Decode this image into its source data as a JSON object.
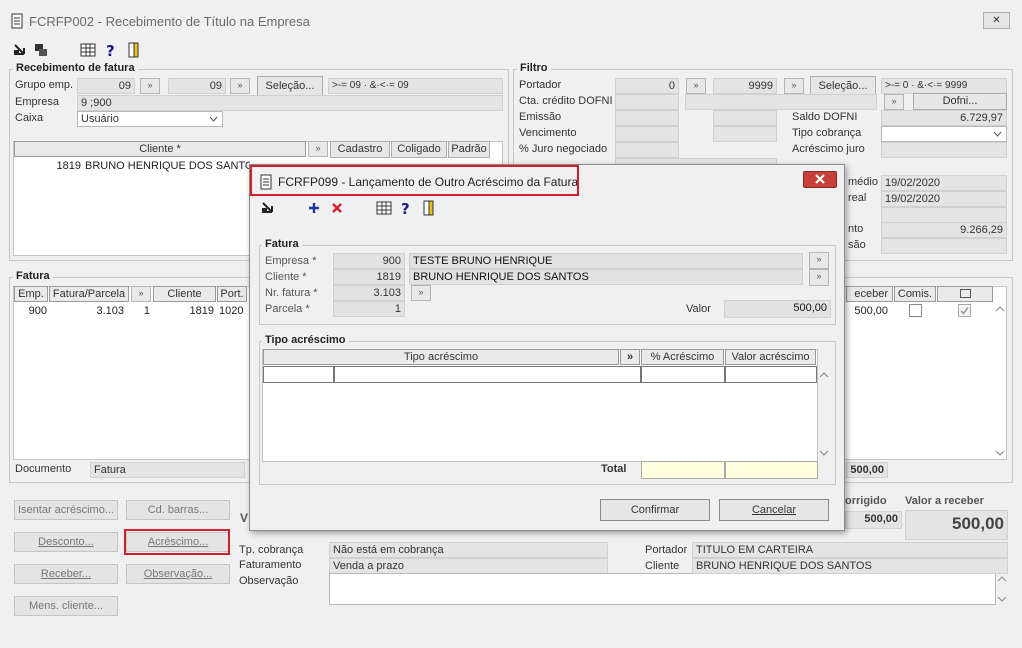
{
  "window": {
    "title": "FCRFP002 - Recebimento de Título na Empresa",
    "close_glyph": "✕"
  },
  "receb": {
    "section_title": "Recebimento de fatura",
    "grupo_label": "Grupo emp.",
    "grupo_from": "09",
    "grupo_to": "09",
    "selecao_label": "Seleção...",
    "grupo_range": ">-= 09 · &·<·= 09",
    "empresa_label": "Empresa",
    "empresa_value": "9 ;900",
    "caixa_label": "Caixa",
    "caixa_value": "Usuário",
    "cliente_col": "Cliente *",
    "cadastro": "Cadastro",
    "coligado": "Coligado",
    "padrao": "Padrão",
    "row_code": "1819",
    "row_name": "BRUNO HENRIQUE DOS SANTOS"
  },
  "filtro": {
    "section_title": "Filtro",
    "portador_label": "Portador",
    "portador_from": "0",
    "portador_to": "9999",
    "selecao_label": "Seleção...",
    "portador_range": ">-= 0 · &·<·= 9999",
    "cta_label": "Cta. crédito DOFNI",
    "dofni_btn": "Dofni...",
    "emissao_label": "Emissão",
    "vencimento_label": "Vencimento",
    "juro_label": "% Juro negociado",
    "saldo_label": "Saldo DOFNI",
    "saldo_value": "6.729,97",
    "tipo_cob_label": "Tipo cobrança",
    "acresc_juro_label": "Acréscimo juro",
    "medio_label": "médio",
    "medio_value": "19/02/2020",
    "real_label": "real",
    "real_value": "19/02/2020",
    "nto_label": "nto",
    "nto_value": "9.266,29",
    "sao_label": "são"
  },
  "fatura": {
    "section_title": "Fatura",
    "cols": [
      "Emp.",
      "Fatura/Parcela",
      "Cliente",
      "Port."
    ],
    "row": {
      "emp": "900",
      "fatura": "3.103",
      "parcela": "1",
      "cliente": "1819",
      "port": "1020"
    },
    "receber_col": "eceber",
    "comis_col": "Comis.",
    "receber_value": "500,00",
    "documento_label": "Documento",
    "documento_value": "Fatura",
    "total_value": "500,00"
  },
  "actions": {
    "isentar": "Isentar acréscimo...",
    "cdbarras": "Cd. barras...",
    "desconto": "Desconto...",
    "acrescimo": "Acréscimo...",
    "receber": "Receber...",
    "observacao": "Observação...",
    "mens_cliente": "Mens. cliente..."
  },
  "bottom": {
    "v_label": "V",
    "corrigido_label": "orrigido",
    "corrigido_value": "500,00",
    "valor_receber_label": "Valor a receber",
    "valor_receber_value": "500,00",
    "tp_cob_label": "Tp. cobrança",
    "tp_cob_value": "Não está em cobrança",
    "faturamento_label": "Faturamento",
    "faturamento_value": "Venda a prazo",
    "observacao_label": "Observação",
    "portador_label": "Portador",
    "portador_value": "TITULO EM CARTEIRA",
    "cliente_label": "Cliente",
    "cliente_value": "BRUNO HENRIQUE DOS SANTOS"
  },
  "dialog": {
    "title": "FCRFP099 - Lançamento de Outro Acréscimo da Fatura",
    "fatura_title": "Fatura",
    "empresa_label": "Empresa *",
    "empresa_code": "900",
    "empresa_name": "TESTE BRUNO HENRIQUE",
    "cliente_label": "Cliente *",
    "cliente_code": "1819",
    "cliente_name": "BRUNO HENRIQUE DOS SANTOS",
    "nr_fatura_label": "Nr. fatura *",
    "nr_fatura_value": "3.103",
    "parcela_label": "Parcela *",
    "parcela_value": "1",
    "valor_label": "Valor",
    "valor_value": "500,00",
    "tipo_title": "Tipo acréscimo",
    "cols": {
      "tipo": "Tipo acréscimo",
      "chev": "»",
      "pct": "% Acréscimo",
      "valor": "Valor acréscimo"
    },
    "total_label": "Total",
    "confirmar": "Confirmar",
    "cancelar": "Cancelar"
  },
  "colors": {
    "highlight": "#d0202a",
    "title_text": "#6a6a6a",
    "total_field": "#ffffe0"
  }
}
